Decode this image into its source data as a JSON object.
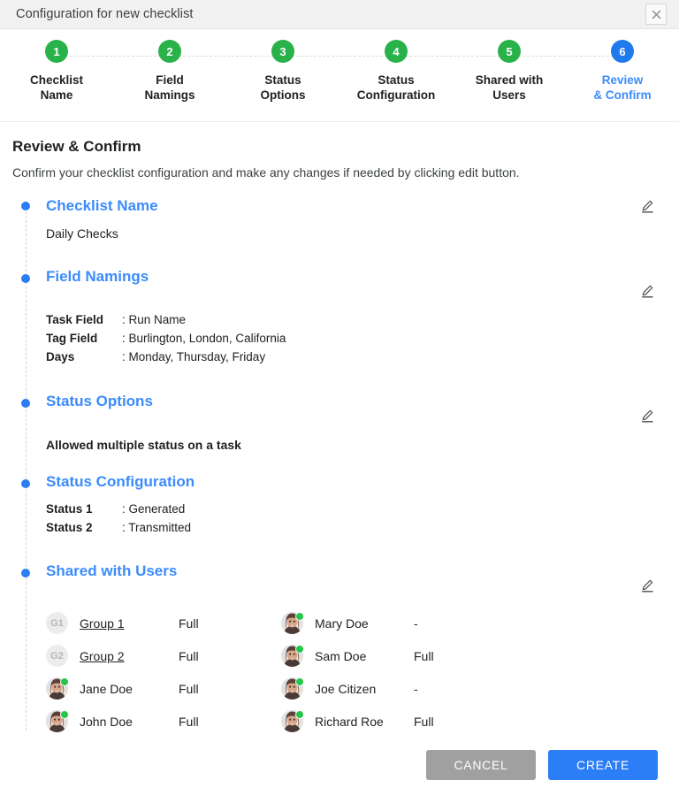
{
  "window": {
    "title": "Configuration for new checklist",
    "close_icon": "close-icon"
  },
  "stepper": {
    "steps": [
      {
        "number": "1",
        "label": "Checklist\nName",
        "state": "done"
      },
      {
        "number": "2",
        "label": "Field\nNamings",
        "state": "done"
      },
      {
        "number": "3",
        "label": "Status\nOptions",
        "state": "done"
      },
      {
        "number": "4",
        "label": "Status\nConfiguration",
        "state": "done"
      },
      {
        "number": "5",
        "label": "Shared with\nUsers",
        "state": "done"
      },
      {
        "number": "6",
        "label": "Review\n& Confirm",
        "state": "active"
      }
    ],
    "colors": {
      "done": "#29b24a",
      "active": "#1f7aec",
      "line": "#dcdce1"
    }
  },
  "page": {
    "title": "Review & Confirm",
    "subtitle": "Confirm your checklist configuration and make any changes if needed by clicking edit button."
  },
  "sections": {
    "checklist_name": {
      "title": "Checklist Name",
      "value": "Daily Checks",
      "edit_icon": "edit-pencil-icon"
    },
    "field_namings": {
      "title": "Field Namings",
      "edit_icon": "edit-pencil-icon",
      "rows": [
        {
          "key": "Task Field",
          "sep": ":",
          "value": "Run Name"
        },
        {
          "key": "Tag Field",
          "sep": ":",
          "value": "Burlington, London, California"
        },
        {
          "key": "Days",
          "sep": ":",
          "value": "Monday, Thursday, Friday"
        }
      ]
    },
    "status_options": {
      "title": "Status Options",
      "value": "Allowed multiple status on a task",
      "edit_icon": "edit-pencil-icon"
    },
    "status_configuration": {
      "title": "Status Configuration",
      "rows": [
        {
          "key": "Status 1",
          "sep": ":",
          "value": "Generated"
        },
        {
          "key": "Status 2",
          "sep": ":",
          "value": "Transmitted"
        }
      ]
    },
    "shared_with_users": {
      "title": "Shared with Users",
      "edit_icon": "edit-pencil-icon",
      "left_column": [
        {
          "avatar_type": "group",
          "initials": "G1",
          "name": "Group 1",
          "link": true,
          "permission": "Full"
        },
        {
          "avatar_type": "group",
          "initials": "G2",
          "name": "Group 2",
          "link": true,
          "permission": "Full"
        },
        {
          "avatar_type": "photo",
          "initials": "",
          "name": "Jane Doe",
          "link": false,
          "permission": "Full"
        },
        {
          "avatar_type": "photo",
          "initials": "",
          "name": "John Doe",
          "link": false,
          "permission": "Full"
        }
      ],
      "right_column": [
        {
          "avatar_type": "photo",
          "initials": "",
          "name": "Mary Doe",
          "link": false,
          "permission": "-"
        },
        {
          "avatar_type": "photo",
          "initials": "",
          "name": "Sam Doe",
          "link": false,
          "permission": "Full"
        },
        {
          "avatar_type": "photo",
          "initials": "",
          "name": "Joe Citizen",
          "link": false,
          "permission": "-"
        },
        {
          "avatar_type": "photo",
          "initials": "",
          "name": "Richard Roe",
          "link": false,
          "permission": "Full"
        }
      ]
    }
  },
  "footer": {
    "cancel_label": "CANCEL",
    "create_label": "CREATE",
    "cancel_color": "#a0a0a0",
    "create_color": "#2b7ef5"
  }
}
